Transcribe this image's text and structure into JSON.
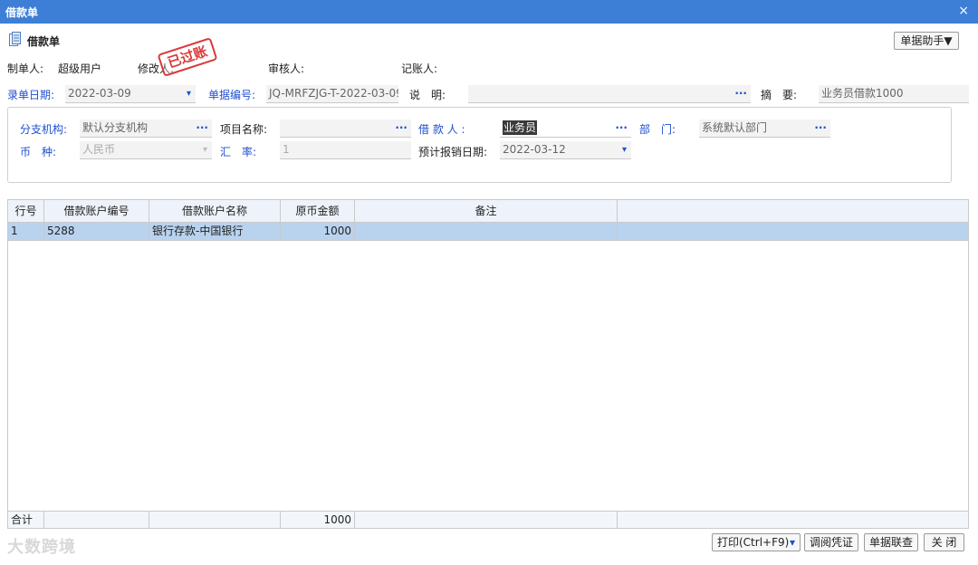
{
  "window": {
    "title": "借款单",
    "close_glyph": "×"
  },
  "doc": {
    "title": "借款单",
    "helper_button": "单据助手▼",
    "stamp": "已过账"
  },
  "meta": {
    "maker_label": "制单人:",
    "maker_value": "超级用户",
    "modifier_label": "修改人:",
    "reviewer_label": "审核人:",
    "poster_label": "记账人:"
  },
  "header_fields": {
    "entry_date_label": "录单日期:",
    "entry_date_value": "2022-03-09",
    "doc_no_label": "单据编号:",
    "doc_no_value": "JQ-MRFZJG-T-2022-03-09",
    "desc_label": "说　明:",
    "desc_value": "",
    "summary_label": "摘　要:",
    "summary_value": "业务员借款1000"
  },
  "group": {
    "branch_label": "分支机构:",
    "branch_value": "默认分支机构",
    "project_label": "项目名称:",
    "project_value": "",
    "borrower_label": "借 款 人 :",
    "borrower_value": "业务员",
    "dept_label": "部　门:",
    "dept_value": "系统默认部门",
    "currency_label": "币　种:",
    "currency_value": "人民币",
    "rate_label": "汇　率:",
    "rate_value": "1",
    "expected_date_label": "预计报销日期:",
    "expected_date_value": "2022-03-12"
  },
  "table": {
    "columns": [
      "行号",
      "借款账户编号",
      "借款账户名称",
      "原币金额",
      "备注"
    ],
    "rows": [
      {
        "row_no": "1",
        "account_no": "5288",
        "account_name": "银行存款-中国银行",
        "amount": "1000",
        "note": ""
      }
    ],
    "footer": {
      "label": "合计",
      "amount_total": "1000"
    }
  },
  "buttons": {
    "print": "打印(Ctrl+F9)",
    "print_arrow": "▾",
    "view_voucher": "调阅凭证",
    "linked_docs": "单据联查",
    "close": "关 闭"
  },
  "watermark": "大数跨境",
  "icons": {
    "document": "document-icon",
    "dots": "···",
    "dropdown": "▾"
  }
}
